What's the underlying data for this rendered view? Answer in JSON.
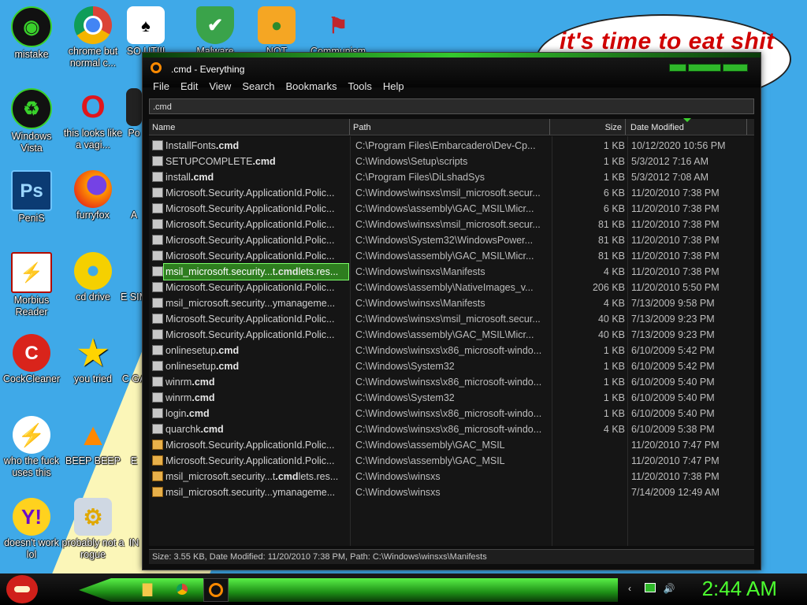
{
  "bubble_text": "it's time to eat shit",
  "desktop_icons": [
    {
      "label": "mistake"
    },
    {
      "label": "chrome but normal c..."
    },
    {
      "label": "SO UTIII"
    },
    {
      "label": "Malware"
    },
    {
      "label": "NOT"
    },
    {
      "label": "Communism"
    },
    {
      "label": "Windows Vista"
    },
    {
      "label": "this looks like a vagi..."
    },
    {
      "label": "Po"
    },
    {
      "label": "PeniS"
    },
    {
      "label": "furryfox"
    },
    {
      "label": "A"
    },
    {
      "label": "Morbius Reader"
    },
    {
      "label": "cd drive"
    },
    {
      "label": "E SIM"
    },
    {
      "label": "CockCleaner"
    },
    {
      "label": "you tried"
    },
    {
      "label": "C GA"
    },
    {
      "label": "who the fuck uses this"
    },
    {
      "label": "BEEP BEEP"
    },
    {
      "label": "E"
    },
    {
      "label": "doesn't work lol"
    },
    {
      "label": "probably not a rogue"
    },
    {
      "label": "IN"
    }
  ],
  "window": {
    "title": ".cmd - Everything",
    "menu": [
      "File",
      "Edit",
      "View",
      "Search",
      "Bookmarks",
      "Tools",
      "Help"
    ],
    "search_value": ".cmd",
    "columns": {
      "name": "Name",
      "path": "Path",
      "size": "Size",
      "date": "Date Modified"
    },
    "rows": [
      {
        "pre": "InstallFonts",
        "hl": ".cmd",
        "post": "",
        "path": "C:\\Program Files\\Embarcadero\\Dev-Cp...",
        "size": "1 KB",
        "date": "10/12/2020 10:56 PM"
      },
      {
        "pre": "SETUPCOMPLETE",
        "hl": ".cmd",
        "post": "",
        "path": "C:\\Windows\\Setup\\scripts",
        "size": "1 KB",
        "date": "5/3/2012 7:16 AM"
      },
      {
        "pre": "install",
        "hl": ".cmd",
        "post": "",
        "path": "C:\\Program Files\\DiLshadSys",
        "size": "1 KB",
        "date": "5/3/2012 7:08 AM"
      },
      {
        "pre": "Microsoft.Security.ApplicationId.Polic...",
        "hl": "",
        "post": "",
        "path": "C:\\Windows\\winsxs\\msil_microsoft.secur...",
        "size": "6 KB",
        "date": "11/20/2010 7:38 PM"
      },
      {
        "pre": "Microsoft.Security.ApplicationId.Polic...",
        "hl": "",
        "post": "",
        "path": "C:\\Windows\\assembly\\GAC_MSIL\\Micr...",
        "size": "6 KB",
        "date": "11/20/2010 7:38 PM"
      },
      {
        "pre": "Microsoft.Security.ApplicationId.Polic...",
        "hl": "",
        "post": "",
        "path": "C:\\Windows\\winsxs\\msil_microsoft.secur...",
        "size": "81 KB",
        "date": "11/20/2010 7:38 PM"
      },
      {
        "pre": "Microsoft.Security.ApplicationId.Polic...",
        "hl": "",
        "post": "",
        "path": "C:\\Windows\\System32\\WindowsPower...",
        "size": "81 KB",
        "date": "11/20/2010 7:38 PM"
      },
      {
        "pre": "Microsoft.Security.ApplicationId.Polic...",
        "hl": "",
        "post": "",
        "path": "C:\\Windows\\assembly\\GAC_MSIL\\Micr...",
        "size": "81 KB",
        "date": "11/20/2010 7:38 PM"
      },
      {
        "pre": "msil_microsoft.security...t",
        "hl": ".cmd",
        "post": "lets.res...",
        "path": "C:\\Windows\\winsxs\\Manifests",
        "size": "4 KB",
        "date": "11/20/2010 7:38 PM",
        "selected": true
      },
      {
        "pre": "Microsoft.Security.ApplicationId.Polic...",
        "hl": "",
        "post": "",
        "path": "C:\\Windows\\assembly\\NativeImages_v...",
        "size": "206 KB",
        "date": "11/20/2010 5:50 PM"
      },
      {
        "pre": "msil_microsoft.security...ymanageme...",
        "hl": "",
        "post": "",
        "path": "C:\\Windows\\winsxs\\Manifests",
        "size": "4 KB",
        "date": "7/13/2009 9:58 PM"
      },
      {
        "pre": "Microsoft.Security.ApplicationId.Polic...",
        "hl": "",
        "post": "",
        "path": "C:\\Windows\\winsxs\\msil_microsoft.secur...",
        "size": "40 KB",
        "date": "7/13/2009 9:23 PM"
      },
      {
        "pre": "Microsoft.Security.ApplicationId.Polic...",
        "hl": "",
        "post": "",
        "path": "C:\\Windows\\assembly\\GAC_MSIL\\Micr...",
        "size": "40 KB",
        "date": "7/13/2009 9:23 PM"
      },
      {
        "pre": "onlinesetup",
        "hl": ".cmd",
        "post": "",
        "path": "C:\\Windows\\winsxs\\x86_microsoft-windo...",
        "size": "1 KB",
        "date": "6/10/2009 5:42 PM"
      },
      {
        "pre": "onlinesetup",
        "hl": ".cmd",
        "post": "",
        "path": "C:\\Windows\\System32",
        "size": "1 KB",
        "date": "6/10/2009 5:42 PM"
      },
      {
        "pre": "winrm",
        "hl": ".cmd",
        "post": "",
        "path": "C:\\Windows\\winsxs\\x86_microsoft-windo...",
        "size": "1 KB",
        "date": "6/10/2009 5:40 PM"
      },
      {
        "pre": "winrm",
        "hl": ".cmd",
        "post": "",
        "path": "C:\\Windows\\System32",
        "size": "1 KB",
        "date": "6/10/2009 5:40 PM"
      },
      {
        "pre": "login",
        "hl": ".cmd",
        "post": "",
        "path": "C:\\Windows\\winsxs\\x86_microsoft-windo...",
        "size": "1 KB",
        "date": "6/10/2009 5:40 PM"
      },
      {
        "pre": "quarchk",
        "hl": ".cmd",
        "post": "",
        "path": "C:\\Windows\\winsxs\\x86_microsoft-windo...",
        "size": "4 KB",
        "date": "6/10/2009 5:38 PM"
      },
      {
        "pre": "Microsoft.Security.ApplicationId.Polic...",
        "hl": "",
        "post": "",
        "path": "C:\\Windows\\assembly\\GAC_MSIL",
        "size": "",
        "date": "11/20/2010 7:47 PM",
        "folder": true
      },
      {
        "pre": "Microsoft.Security.ApplicationId.Polic...",
        "hl": "",
        "post": "",
        "path": "C:\\Windows\\assembly\\GAC_MSIL",
        "size": "",
        "date": "11/20/2010 7:47 PM",
        "folder": true
      },
      {
        "pre": "msil_microsoft.security...t",
        "hl": ".cmd",
        "post": "lets.res...",
        "path": "C:\\Windows\\winsxs",
        "size": "",
        "date": "11/20/2010 7:38 PM",
        "folder": true
      },
      {
        "pre": "msil_microsoft.security...ymanageme...",
        "hl": "",
        "post": "",
        "path": "C:\\Windows\\winsxs",
        "size": "",
        "date": "7/14/2009 12:49 AM",
        "folder": true
      }
    ],
    "status": "Size: 3.55 KB, Date Modified: 11/20/2010 7:38 PM, Path: C:\\Windows\\winsxs\\Manifests"
  },
  "taskbar": {
    "clock": "2:44 AM"
  },
  "colors": {
    "desktop": "#3fa9e8",
    "accent_green": "#2fb82a",
    "clock_green": "#4cff2f",
    "bubble_text": "#d10000"
  }
}
